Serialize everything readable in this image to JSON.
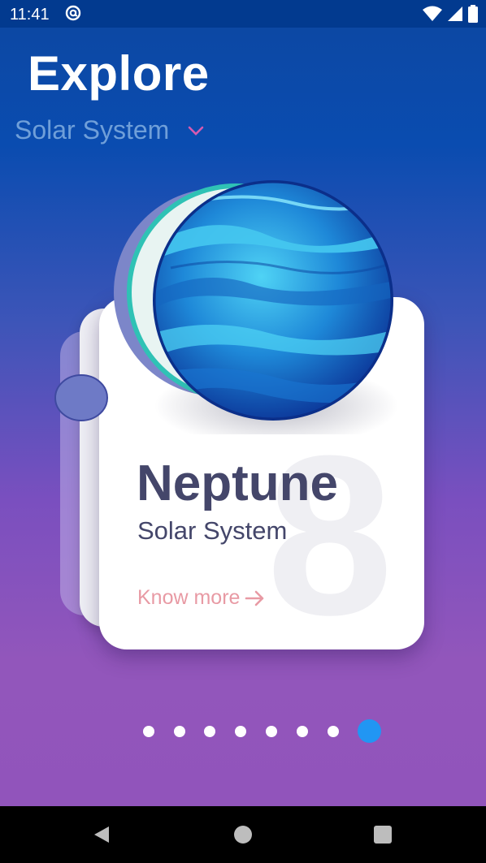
{
  "status_bar": {
    "time": "11:41",
    "icons": [
      "at-sign-icon",
      "wifi-icon",
      "signal-icon",
      "battery-icon"
    ]
  },
  "header": {
    "title": "Explore",
    "selector_label": "Solar System",
    "selector_icon": "chevron-down-icon"
  },
  "card": {
    "planet_name": "Neptune",
    "planet_system": "Solar System",
    "planet_number": "8",
    "link_label": "Know more",
    "link_icon": "arrow-right-icon"
  },
  "pager": {
    "total": 8,
    "active_index": 7
  },
  "colors": {
    "accent_blue": "#2196f3",
    "link_pink": "#e89aa4",
    "text_dark": "#44466a",
    "subtitle_blue": "#6f9fd9",
    "chevron_pink": "#d65bb0"
  },
  "nav_bar": {
    "buttons": [
      "back-icon",
      "home-icon",
      "recents-icon"
    ]
  }
}
